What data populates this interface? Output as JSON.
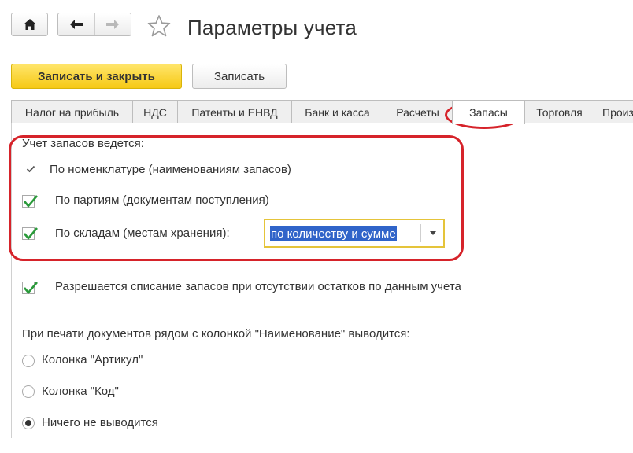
{
  "header": {
    "title": "Параметры учета"
  },
  "toolbar": {
    "save_close_label": "Записать и закрыть",
    "save_label": "Записать"
  },
  "tabs": [
    {
      "label": "Налог на прибыль"
    },
    {
      "label": "НДС"
    },
    {
      "label": "Патенты и ЕНВД"
    },
    {
      "label": "Банк и касса"
    },
    {
      "label": "Расчеты"
    },
    {
      "label": "Запасы",
      "active": true
    },
    {
      "label": "Торговля"
    },
    {
      "label": "Произ"
    }
  ],
  "inventory": {
    "section_label": "Учет запасов ведется:",
    "by_nomenclature": {
      "label": "По номенклатуре (наименованиям запасов)",
      "checked": true
    },
    "by_batches": {
      "label": "По партиям (документам поступления)",
      "checked": true
    },
    "by_warehouses": {
      "label": "По складам (местам хранения):",
      "checked": true
    },
    "warehouse_mode": {
      "value": "по количеству и сумме"
    }
  },
  "allow_writeoff": {
    "label": "Разрешается списание запасов при отсутствии остатков по данным учета",
    "checked": true
  },
  "print_options": {
    "label": "При печати документов рядом с колонкой \"Наименование\" выводится:",
    "options": [
      {
        "label": "Колонка \"Артикул\"",
        "selected": false
      },
      {
        "label": "Колонка \"Код\"",
        "selected": false
      },
      {
        "label": "Ничего не выводится",
        "selected": true
      }
    ]
  },
  "colors": {
    "accent_yellow": "#f6c915",
    "highlight_red": "#d6232a",
    "check_green": "#2a9a3a",
    "selection_blue": "#3064c9"
  }
}
